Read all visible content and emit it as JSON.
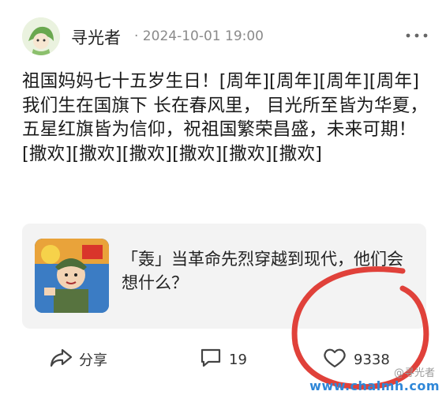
{
  "post": {
    "author": "寻光者",
    "timestamp": "· 2024-10-01 19:00",
    "body": "祖国妈妈七十五岁生日！[周年][周年][周年][周年]我们生在国旗下 长在春风里， 目光所至皆为华夏， 五星红旗皆为信仰，祝祖国繁荣昌盛，未来可期！[撒欢][撒欢][撒欢][撒欢][撒欢][撒欢]"
  },
  "card": {
    "title": "「轰」当革命先烈穿越到现代，他们会想什么？"
  },
  "actions": {
    "share_label": "分享",
    "comment_count": "19",
    "like_count": "9338"
  },
  "watermark": {
    "site": "www.chalmh.com",
    "handle": "@寻光者"
  },
  "colors": {
    "accent_red": "#e0413a",
    "watermark_blue": "#2f87d8",
    "card_bg": "#f3f3f3"
  },
  "icons": [
    "avatar-image",
    "more-icon",
    "share-icon",
    "comment-icon",
    "heart-icon"
  ]
}
